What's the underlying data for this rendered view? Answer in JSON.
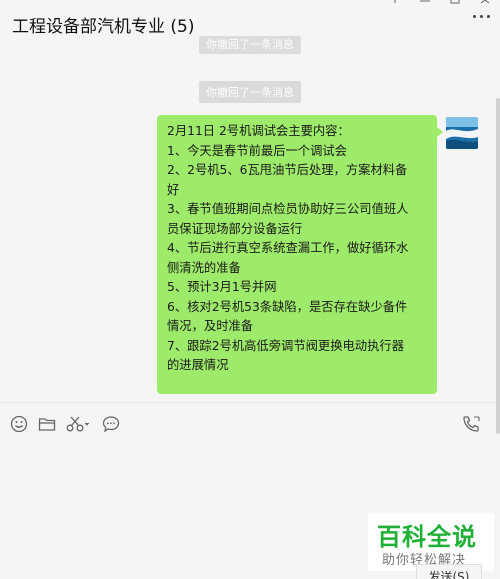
{
  "header": {
    "title": "工程设备部汽机专业 (5)"
  },
  "chat": {
    "system_messages": [
      "你撤回了一条消息",
      "你撤回了一条消息"
    ],
    "message_lines": [
      "2月11日 2号机调试会主要内容：",
      "1、今天是春节前最后一个调试会",
      "2、2号机5、6瓦甩油节后处理，方案材料备",
      "好",
      "3、春节值班期间点检员协助好三公司值班人",
      "员保证现场部分设备运行",
      "4、节后进行真空系统查漏工作，做好循环水",
      "侧清洗的准备",
      "5、预计3月1号并网",
      "6、核对2号机53条缺陷，是否存在缺少备件",
      "情况，及时准备",
      "7、跟踪2号机高低旁调节阀更换电动执行器",
      "的进展情况"
    ]
  },
  "toolbar": {
    "icons": [
      "emoji-icon",
      "folder-icon",
      "scissors-icon",
      "chat-bubble-icon",
      "phone-icon"
    ]
  },
  "watermark": {
    "title": "百科全说",
    "subtitle": "助你轻松解决"
  },
  "send_button": {
    "label": "发送(S)"
  },
  "colors": {
    "bubble": "#9eea6a",
    "background": "#f5f5f5",
    "watermark_green": "#20b038"
  }
}
